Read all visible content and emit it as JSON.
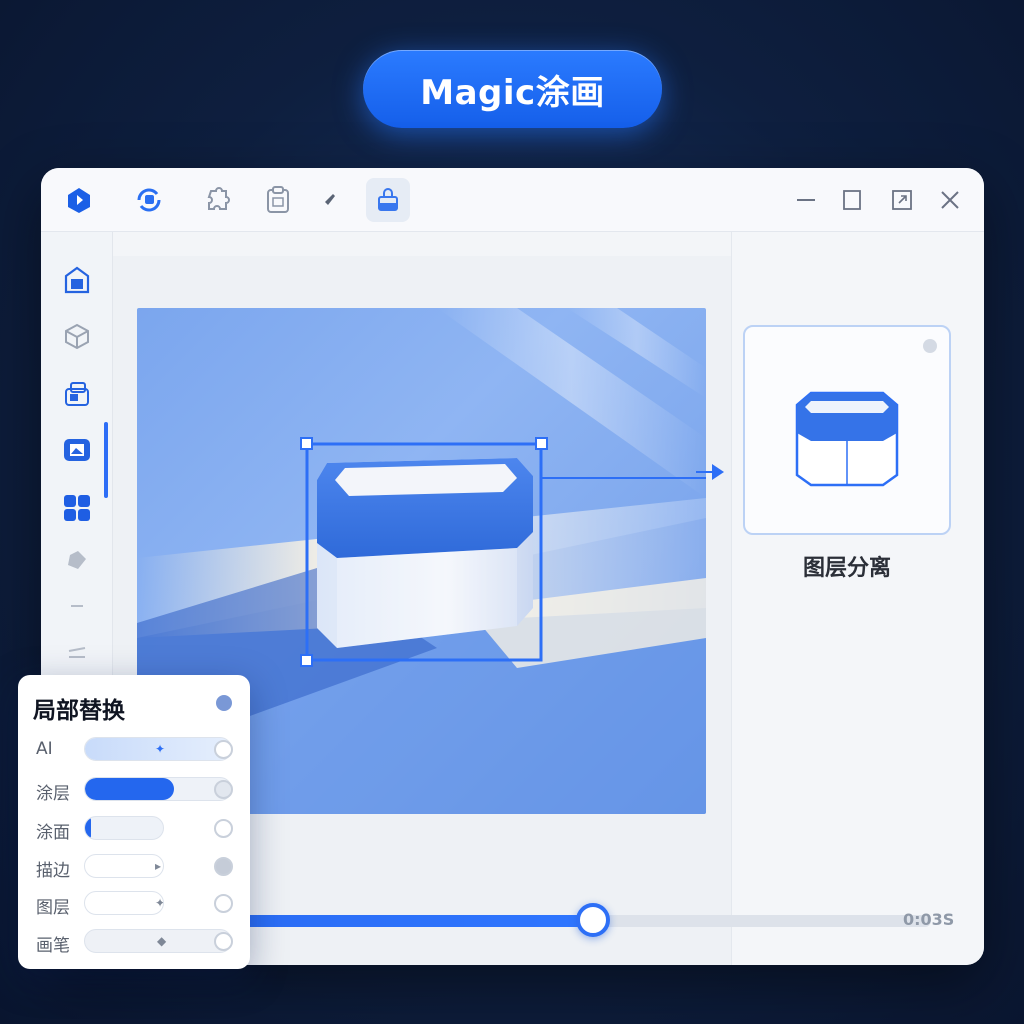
{
  "banner": {
    "label": "Magic涂画"
  },
  "toolbar": {
    "tools": [
      {
        "icon": "app-logo-icon"
      },
      {
        "icon": "brush-refresh-icon"
      },
      {
        "icon": "puzzle-icon"
      },
      {
        "icon": "clipboard-icon"
      },
      {
        "icon": "pin-icon"
      },
      {
        "icon": "paint-bucket-icon",
        "active": true
      }
    ],
    "window_controls": [
      "minimize-icon",
      "restore-icon",
      "maximize-icon",
      "close-icon"
    ]
  },
  "sidebar": {
    "items": [
      {
        "icon": "gallery-icon"
      },
      {
        "icon": "cube-icon"
      },
      {
        "icon": "layers-box-icon"
      },
      {
        "icon": "image-frame-icon",
        "active": true
      },
      {
        "icon": "grid-icon"
      },
      {
        "icon": "eraser-icon"
      },
      {
        "icon": "line-icon"
      },
      {
        "icon": "sliders-icon"
      }
    ]
  },
  "preview": {
    "label": "图层分离"
  },
  "timeline": {
    "progress": 0.51,
    "value_text": "0:03S"
  },
  "panel": {
    "title": "局部替换",
    "rows": [
      {
        "label": "AI",
        "fill": 1.0,
        "style": "light",
        "marker": "✦"
      },
      {
        "label": "涂层",
        "fill": 0.6,
        "style": "solid",
        "marker": ""
      },
      {
        "label": "涂面",
        "fill": 0.08,
        "style": "solid",
        "marker": ""
      },
      {
        "label": "描边",
        "fill": 0.0,
        "style": "empty",
        "marker": "▸"
      },
      {
        "label": "图层",
        "fill": 0.0,
        "style": "empty",
        "marker": "✦"
      },
      {
        "label": "画笔",
        "fill": 0.0,
        "style": "empty",
        "marker": "◆"
      }
    ]
  },
  "colors": {
    "accent": "#2d6ff6",
    "pill": "#1a64f0",
    "background": "#0e1f3f"
  }
}
